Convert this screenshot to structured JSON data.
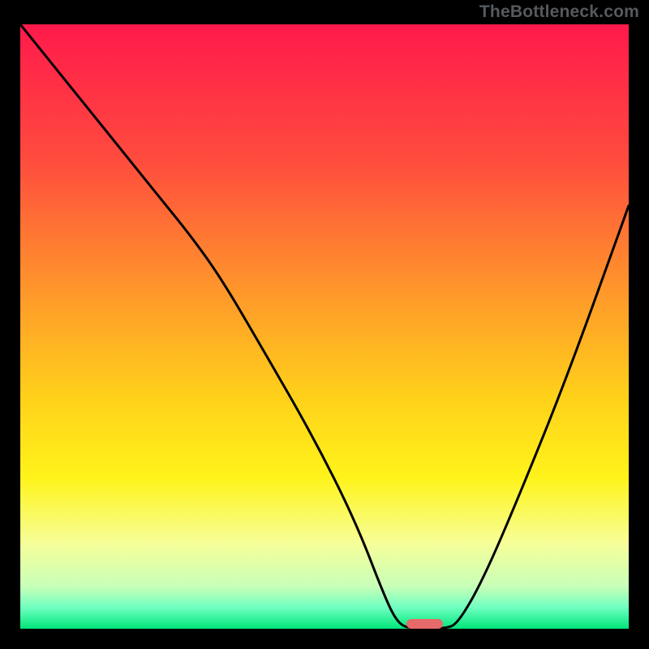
{
  "watermark": "TheBottleneck.com",
  "chart_data": {
    "type": "line",
    "title": "",
    "xlabel": "",
    "ylabel": "",
    "xlim": [
      0,
      100
    ],
    "ylim": [
      0,
      100
    ],
    "grid": false,
    "legend": false,
    "background_gradient": {
      "stops": [
        {
          "pos": 0.0,
          "color": "#ff1a4b"
        },
        {
          "pos": 0.22,
          "color": "#ff4a3e"
        },
        {
          "pos": 0.45,
          "color": "#ff9a2a"
        },
        {
          "pos": 0.62,
          "color": "#ffd21a"
        },
        {
          "pos": 0.75,
          "color": "#fff31a"
        },
        {
          "pos": 0.86,
          "color": "#f6ff9a"
        },
        {
          "pos": 0.93,
          "color": "#c8ffb8"
        },
        {
          "pos": 0.965,
          "color": "#6fffc0"
        },
        {
          "pos": 1.0,
          "color": "#00e67a"
        }
      ]
    },
    "series": [
      {
        "name": "bottleneck-curve",
        "color": "#000000",
        "x": [
          0,
          8,
          16,
          24,
          28,
          33,
          40,
          48,
          55,
          60,
          62,
          64,
          70,
          72,
          76,
          82,
          90,
          100
        ],
        "y": [
          100,
          90,
          80,
          70,
          65,
          58,
          46,
          32,
          18,
          5,
          1,
          0,
          0,
          1,
          8,
          22,
          42,
          70
        ]
      }
    ],
    "marker": {
      "name": "optimal-range",
      "x_start": 63.5,
      "x_end": 69.5,
      "color": "#e66a6a"
    }
  }
}
